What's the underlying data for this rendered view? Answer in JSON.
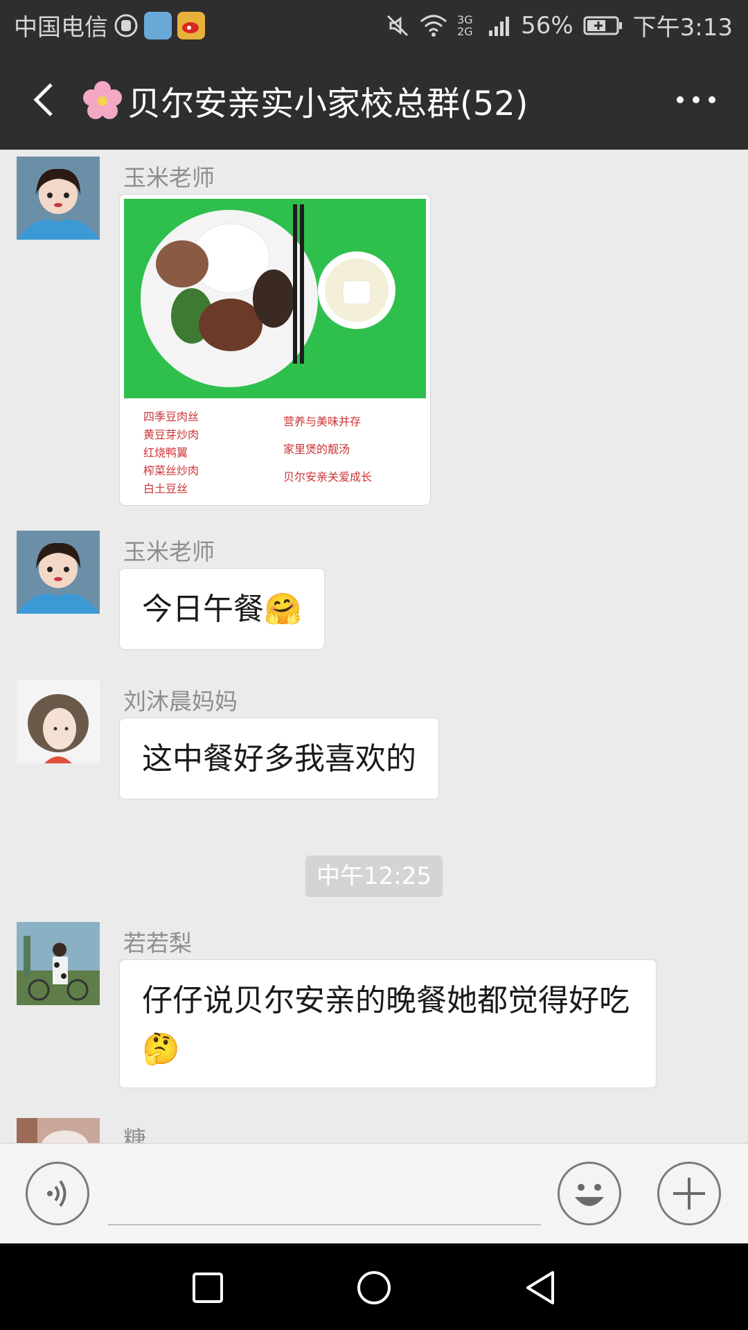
{
  "status_bar": {
    "carrier": "中国电信",
    "network": "3G 2G",
    "battery": "56%",
    "time": "下午3:13"
  },
  "header": {
    "title": "贝尔安亲实小家校总群(52)",
    "title_icon": "cherry-blossom-icon"
  },
  "messages": [
    {
      "sender": "玉米老师",
      "type": "image",
      "image_lines_left": [
        "四季豆肉丝",
        "黄豆芽炒肉",
        "红烧鸭翼",
        "榨菜丝炒肉",
        "白土豆丝"
      ],
      "image_lines_right": [
        "营养与美味并存",
        "家里煲的靓汤",
        "贝尔安亲关爱成长"
      ]
    },
    {
      "sender": "玉米老师",
      "type": "text",
      "text": "今日午餐",
      "emoji": "🤗"
    },
    {
      "sender": "刘沐晨妈妈",
      "type": "text",
      "text": "这中餐好多我喜欢的"
    },
    {
      "type": "time",
      "text": "中午12:25"
    },
    {
      "sender": "若若梨",
      "type": "text",
      "text": "仔仔说贝尔安亲的晚餐她都觉得好吃",
      "emoji": "🤔"
    },
    {
      "sender": "糖",
      "type": "partial"
    }
  ],
  "colors": {
    "bar": "#2e2e2e",
    "chat_bg": "#ebebeb",
    "bubble": "#ffffff"
  }
}
